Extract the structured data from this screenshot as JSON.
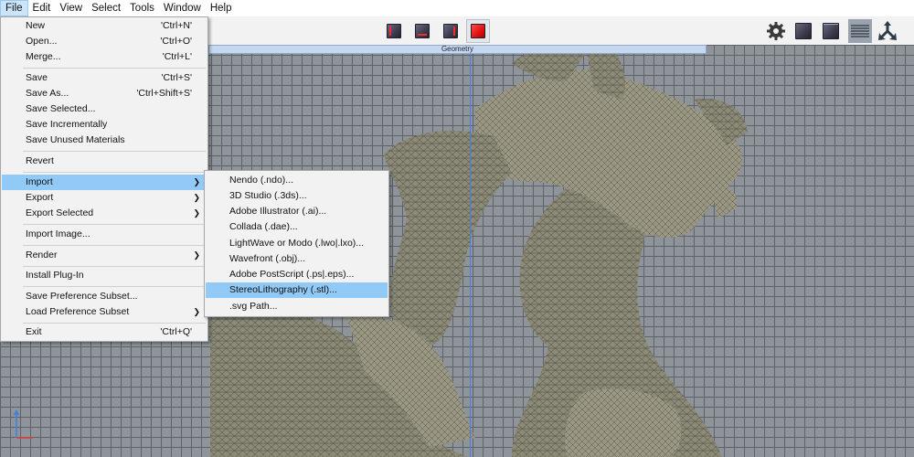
{
  "menubar": {
    "items": [
      "File",
      "Edit",
      "View",
      "Select",
      "Tools",
      "Window",
      "Help"
    ],
    "active": "File"
  },
  "toolbar": {
    "view_modes": [
      "front-view-cube-icon",
      "side-view-cube-icon",
      "perspective-view-cube-icon",
      "solid-view-cube-icon"
    ],
    "right_tools": [
      "gear-icon",
      "cube-icon",
      "cube-wire-icon",
      "layers-icon",
      "axis-tool-icon"
    ],
    "accent_color": "#ff2a2a"
  },
  "viewport": {
    "panel_label": "Geometry",
    "grid_color": "#5d6369",
    "background_color": "#8e9499",
    "axis_color": "#3f7fe8"
  },
  "file_menu": {
    "items": [
      {
        "label": "New",
        "shortcut": "'Ctrl+N'"
      },
      {
        "label": "Open...",
        "shortcut": "'Ctrl+O'"
      },
      {
        "label": "Merge...",
        "shortcut": "'Ctrl+L'"
      },
      {
        "label": "Save",
        "shortcut": "'Ctrl+S'"
      },
      {
        "label": "Save As...",
        "shortcut": "'Ctrl+Shift+S'"
      },
      {
        "label": "Save Selected...",
        "shortcut": ""
      },
      {
        "label": "Save Incrementally",
        "shortcut": ""
      },
      {
        "label": "Save Unused Materials",
        "shortcut": ""
      },
      {
        "label": "Revert",
        "shortcut": ""
      },
      {
        "label": "Import",
        "shortcut": "",
        "submenu": true
      },
      {
        "label": "Export",
        "shortcut": "",
        "submenu": true
      },
      {
        "label": "Export Selected",
        "shortcut": "",
        "submenu": true
      },
      {
        "label": "Import Image...",
        "shortcut": ""
      },
      {
        "label": "Render",
        "shortcut": "",
        "submenu": true
      },
      {
        "label": "Install Plug-In",
        "shortcut": ""
      },
      {
        "label": "Save Preference Subset...",
        "shortcut": ""
      },
      {
        "label": "Load Preference Subset",
        "shortcut": "",
        "submenu": true
      },
      {
        "label": "Exit",
        "shortcut": "'Ctrl+Q'"
      }
    ],
    "highlighted": "Import"
  },
  "import_submenu": {
    "items": [
      "Nendo (.ndo)...",
      "3D Studio (.3ds)...",
      "Adobe Illustrator (.ai)...",
      "Collada (.dae)...",
      "LightWave or Modo (.lwo|.lxo)...",
      "Wavefront (.obj)...",
      "Adobe PostScript (.ps|.eps)...",
      "StereoLithography (.stl)...",
      ".svg Path..."
    ],
    "highlighted": "StereoLithography (.stl)..."
  }
}
